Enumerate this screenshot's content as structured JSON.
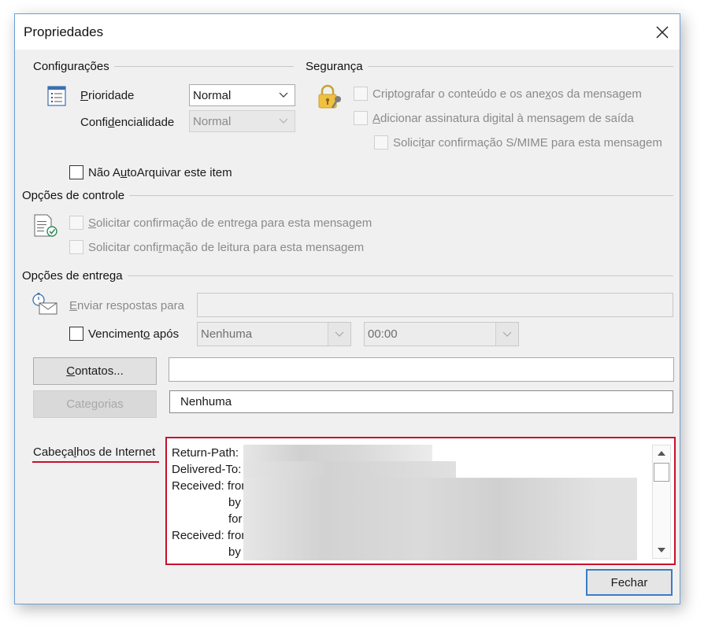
{
  "window": {
    "title": "Propriedades",
    "close_label": "×"
  },
  "settings": {
    "group_label": "Configurações",
    "priority": {
      "label_underline": "P",
      "label_rest": "rioridade",
      "value": "Normal"
    },
    "confidentiality": {
      "label_pre": "Confi",
      "label_underline": "d",
      "label_rest": "encialidade",
      "value": "Normal"
    },
    "no_autoarchive": {
      "label_pre": "Não A",
      "label_underline": "u",
      "label_rest": "toArquivar este item"
    }
  },
  "security": {
    "group_label": "Segurança",
    "encrypt": {
      "label_pre": "Criptografar o conteúdo e os ane",
      "label_underline": "x",
      "label_rest": "os da mensagem"
    },
    "sign": {
      "label_pre": "",
      "label_underline": "A",
      "label_rest": "dicionar assinatura digital à mensagem de saída"
    },
    "smime": {
      "label_pre": "Solici",
      "label_underline": "t",
      "label_rest": "ar confirmação S/MIME para esta mensagem"
    }
  },
  "tracking": {
    "group_label": "Opções de controle",
    "delivery_receipt": {
      "label_pre": "",
      "label_underline": "S",
      "label_rest": "olicitar confirmação de entrega para esta mensagem"
    },
    "read_receipt": {
      "label_pre": "Solicitar confi",
      "label_underline": "r",
      "label_rest": "mação de leitura para esta mensagem"
    }
  },
  "delivery": {
    "group_label": "Opções de entrega",
    "reply_to": {
      "label_underline": "E",
      "label_rest": "nviar respostas para",
      "value": ""
    },
    "expires": {
      "label_pre": "Venciment",
      "label_underline": "o",
      "label_rest": " após",
      "date_value": "Nenhuma",
      "time_value": "00:00"
    },
    "contacts_button": {
      "label_underline": "C",
      "label_rest": "ontatos..."
    },
    "contacts_value": "",
    "categories_button": "Categorias",
    "categories_value": "Nenhuma"
  },
  "internet_headers": {
    "label_pre": "Cabeça",
    "label_underline": "l",
    "label_rest": "hos de Internet",
    "lines": [
      "Return-Path:",
      "Delivered-To:",
      "Received: from",
      "by",
      "for",
      "Received: from",
      "by"
    ]
  },
  "footer": {
    "close_button": "Fechar"
  },
  "colors": {
    "highlight_border": "#c8102e",
    "default_button_border": "#3a7cc8"
  }
}
